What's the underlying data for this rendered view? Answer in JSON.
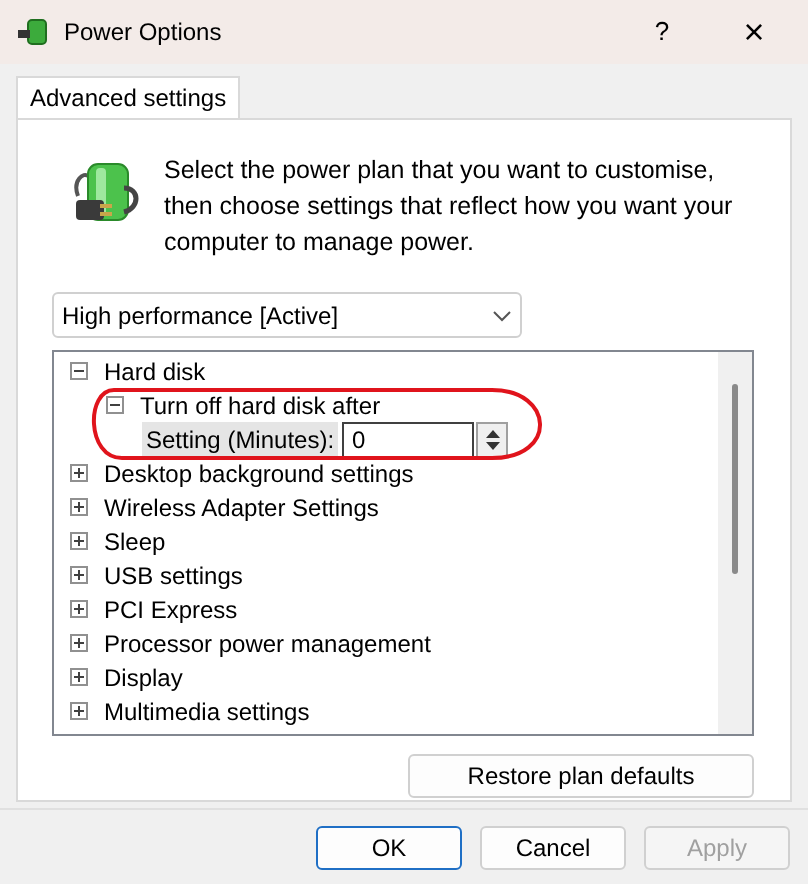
{
  "window": {
    "title": "Power Options",
    "help": "?",
    "close": "×"
  },
  "tabs": [
    {
      "label": "Advanced settings",
      "selected": true
    }
  ],
  "intro": "Select the power plan that you want to customise, then choose settings that reflect how you want your computer to manage power.",
  "plan_dropdown": {
    "value": "High performance [Active]"
  },
  "tree": [
    {
      "label": "Hard disk",
      "expanded": true,
      "children": [
        {
          "label": "Turn off hard disk after",
          "expanded": true,
          "children": [
            {
              "kind": "spinner",
              "label": "Setting (Minutes):",
              "value": "0",
              "selected": true
            }
          ]
        }
      ]
    },
    {
      "label": "Desktop background settings",
      "expanded": false
    },
    {
      "label": "Wireless Adapter Settings",
      "expanded": false
    },
    {
      "label": "Sleep",
      "expanded": false
    },
    {
      "label": "USB settings",
      "expanded": false
    },
    {
      "label": "PCI Express",
      "expanded": false
    },
    {
      "label": "Processor power management",
      "expanded": false
    },
    {
      "label": "Display",
      "expanded": false
    },
    {
      "label": "Multimedia settings",
      "expanded": false
    }
  ],
  "restore_button": "Restore plan defaults",
  "buttons": [
    {
      "label": "OK",
      "disabled": false,
      "default": true
    },
    {
      "label": "Cancel",
      "disabled": false,
      "default": false
    },
    {
      "label": "Apply",
      "disabled": true,
      "default": false
    }
  ]
}
